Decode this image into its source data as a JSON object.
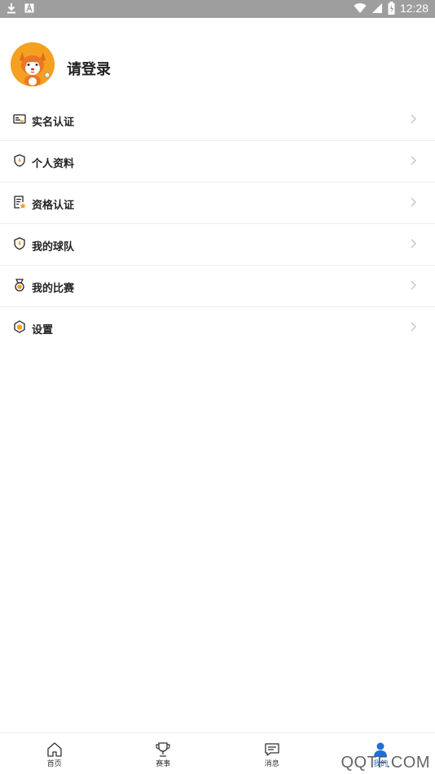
{
  "status_bar": {
    "time": "12:28",
    "left_icons": [
      "download-icon",
      "a-notification-icon"
    ],
    "right_icons": [
      "wifi-icon",
      "signal-icon",
      "battery-icon"
    ]
  },
  "profile": {
    "login_text": "请登录",
    "avatar_icon": "squirrel-mascot-avatar"
  },
  "menu": {
    "items": [
      {
        "label": "实名认证",
        "icon": "id-card-icon"
      },
      {
        "label": "个人资料",
        "icon": "shield-profile-icon"
      },
      {
        "label": "资格认证",
        "icon": "certificate-icon"
      },
      {
        "label": "我的球队",
        "icon": "shield-team-icon"
      },
      {
        "label": "我的比赛",
        "icon": "medal-icon"
      },
      {
        "label": "设置",
        "icon": "hexagon-settings-icon"
      }
    ]
  },
  "bottom_nav": {
    "items": [
      {
        "label": "首页",
        "icon": "home-icon"
      },
      {
        "label": "赛事",
        "icon": "trophy-icon"
      },
      {
        "label": "消息",
        "icon": "message-icon"
      },
      {
        "label": "我的",
        "icon": "user-icon",
        "active": true
      }
    ]
  },
  "watermark": "QQTF.COM",
  "colors": {
    "status_bar": "#9e9e9e",
    "accent_yellow": "#f5a020",
    "active_nav": "#1e6fd9",
    "chevron": "#c8c8c8"
  }
}
